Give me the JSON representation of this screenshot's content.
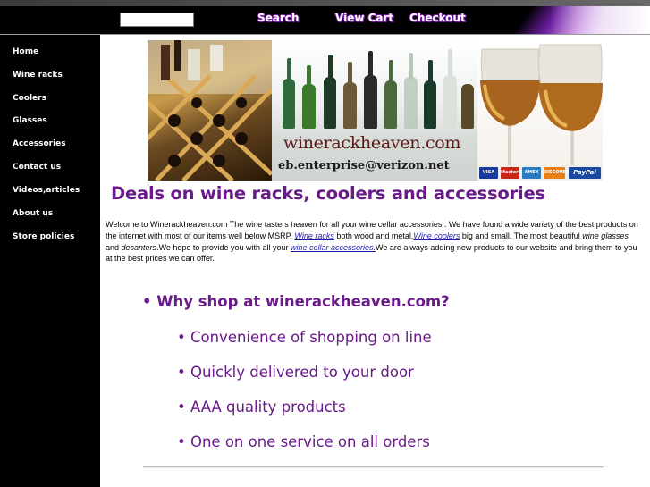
{
  "header": {
    "search_placeholder": "",
    "links": [
      "Search",
      "View Cart",
      "Checkout"
    ]
  },
  "sidebar": {
    "items": [
      {
        "label": "Home"
      },
      {
        "label": "Wine racks"
      },
      {
        "label": "Coolers"
      },
      {
        "label": "Glasses"
      },
      {
        "label": "Accessories"
      },
      {
        "label": "Contact us"
      },
      {
        "label": "Videos,articles"
      },
      {
        "label": "About us"
      },
      {
        "label": "Store policies"
      }
    ]
  },
  "banner": {
    "site": "winerackheaven.com",
    "email": "eb.enterprise@verizon.net",
    "cards": [
      "VISA",
      "MasterCard",
      "AMEX",
      "DISCOVER",
      "PayPal"
    ]
  },
  "main": {
    "headline": "Deals on wine racks, coolers and accessories",
    "intro": {
      "t1": "Welcome to Winerackheaven.com The wine tasters heaven for all your wine cellar accessories . We have found a wide variety of the best products on the internet with most of our items well below MSRP. ",
      "link1": "Wine racks",
      "t2": " both wood and metal.",
      "link2": "Wine coolers",
      "t3": " big and small. The most beautiful ",
      "i1": "wine glasses",
      "t4": " and ",
      "i2": "decanters",
      "t5": ".We hope to provide you with all your ",
      "link3": "wine cellar accessories.",
      "t6": "We are always adding new products to our website and bring them to you at the best prices we can offer."
    },
    "why_heading": "• Why shop at winerackheaven.com?",
    "bullets": [
      "• Convenience of shopping on line",
      "• Quickly delivered to your door",
      "• AAA quality products",
      "• One on one service on all orders"
    ]
  },
  "colors": {
    "accent_purple": "#6a1a8a",
    "sidebar_bg": "#000000",
    "link_blue": "#1a1aa8"
  }
}
